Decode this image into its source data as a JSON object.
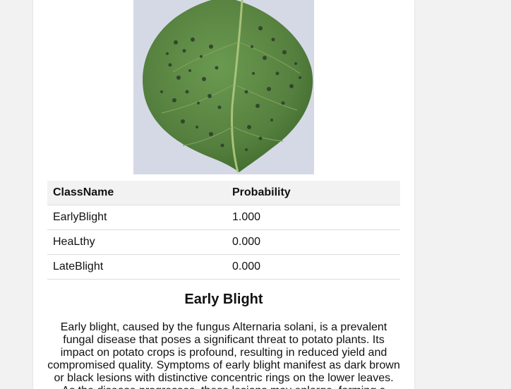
{
  "image": {
    "alt": "potato leaf sample"
  },
  "results_table": {
    "headers": {
      "class_name": "ClassName",
      "probability": "Probability"
    },
    "rows": [
      {
        "class_name": "EarlyBlight",
        "probability": "1.000"
      },
      {
        "class_name": "HeaLthy",
        "probability": "0.000"
      },
      {
        "class_name": "LateBlight",
        "probability": "0.000"
      }
    ]
  },
  "disease": {
    "title": "Early Blight",
    "description": "Early blight, caused by the fungus Alternaria solani, is a prevalent fungal disease that poses a significant threat to potato plants. Its impact on potato crops is profound, resulting in reduced yield and compromised quality. Symptoms of early blight manifest as dark brown or black lesions with distinctive concentric rings on the lower leaves. As the disease progresses, these lesions may enlarge, forming a"
  },
  "colors": {
    "page_background": "#f2f2f2",
    "card_background": "#ffffff",
    "table_header_background": "#f2f2f2",
    "leaf_green": "#5a8a43"
  }
}
